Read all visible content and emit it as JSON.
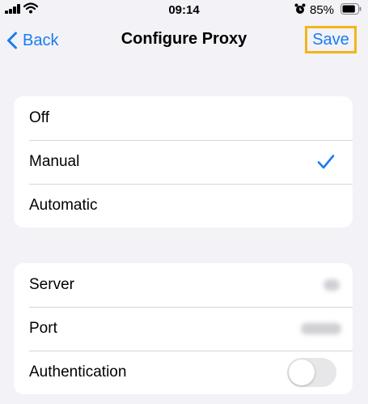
{
  "status_bar": {
    "time": "09:14",
    "battery_percent": "85%",
    "battery_level": 0.85,
    "icons": [
      "cellular-signal-icon",
      "wifi-icon",
      "alarm-icon",
      "battery-icon"
    ]
  },
  "nav": {
    "back_label": "Back",
    "title": "Configure Proxy",
    "save_label": "Save"
  },
  "proxy_mode": {
    "options": [
      "Off",
      "Manual",
      "Automatic"
    ],
    "selected": "Manual"
  },
  "settings": {
    "server_label": "Server",
    "port_label": "Port",
    "authentication_label": "Authentication",
    "authentication_enabled": false
  },
  "colors": {
    "accent": "#1a7cf0",
    "highlight": "#f3b519",
    "background": "#f2f2f7"
  }
}
